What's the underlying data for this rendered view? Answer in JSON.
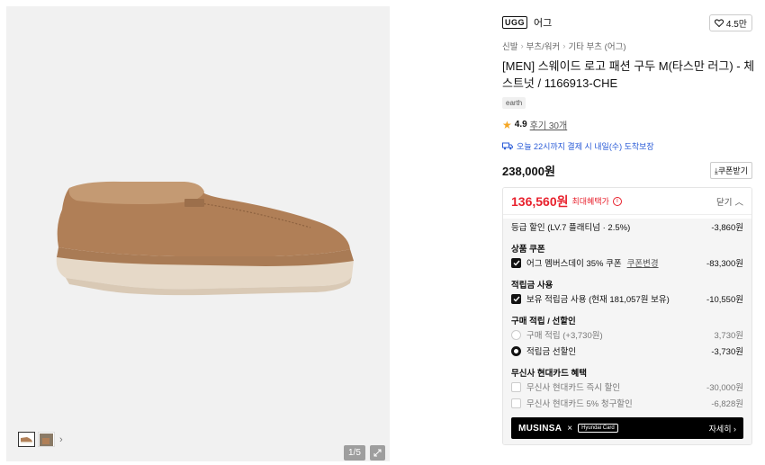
{
  "gallery": {
    "counter": "1/5",
    "icons": {
      "expand": "expand-icon",
      "next": "chevron-right-icon"
    }
  },
  "brand": {
    "logo_text": "UGG",
    "name": "어그",
    "likes": "4.5만"
  },
  "breadcrumb": [
    "신발",
    "부츠/워커",
    "기타 부츠 (어그)"
  ],
  "product": {
    "title": "[MEN] 스웨이드 로고 패션 구두 M(타스만 러그) - 체스트넛 / 1166913-CHE",
    "tag": "earth",
    "rating": "4.9",
    "reviews": "후기 30개",
    "delivery": "오늘 22시까지 결제 시 내일(수) 도착보장",
    "price": "238,000원",
    "coupon_button": "쿠폰받기"
  },
  "benefit": {
    "final_price": "136,560원",
    "label": "최대혜택가",
    "collapse": "닫기",
    "grade_discount": {
      "label": "등급 할인 (LV.7 플래티넘 · 2.5%)",
      "amount": "-3,860원"
    },
    "coupon_title": "상품 쿠폰",
    "coupon": {
      "label": "어그 멤버스데이 35% 쿠폰",
      "change": "쿠폰변경",
      "amount": "-83,300원"
    },
    "points_title": "적립금 사용",
    "points": {
      "label": "보유 적립금 사용 (현재 181,057원 보유)",
      "amount": "-10,550원"
    },
    "purchase_title": "구매 적립 / 선할인",
    "purchase_points": {
      "label": "구매 적립 (+3,730원)",
      "amount": "3,730원"
    },
    "pre_discount": {
      "label": "적립금 선할인",
      "amount": "-3,730원"
    },
    "card_title": "무신사 현대카드 혜택",
    "card_instant": {
      "label": "무신사 현대카드 즉시 할인",
      "amount": "-30,000원"
    },
    "card_billing": {
      "label": "무신사 현대카드 5% 청구할인",
      "amount": "-6,828원"
    },
    "banner": {
      "brand": "MUSINSA",
      "x": "×",
      "card": "Hyundai Card",
      "more": "자세히"
    }
  },
  "colors": {
    "accent_red": "#e8212d",
    "delivery_blue": "#2a5bd7"
  }
}
